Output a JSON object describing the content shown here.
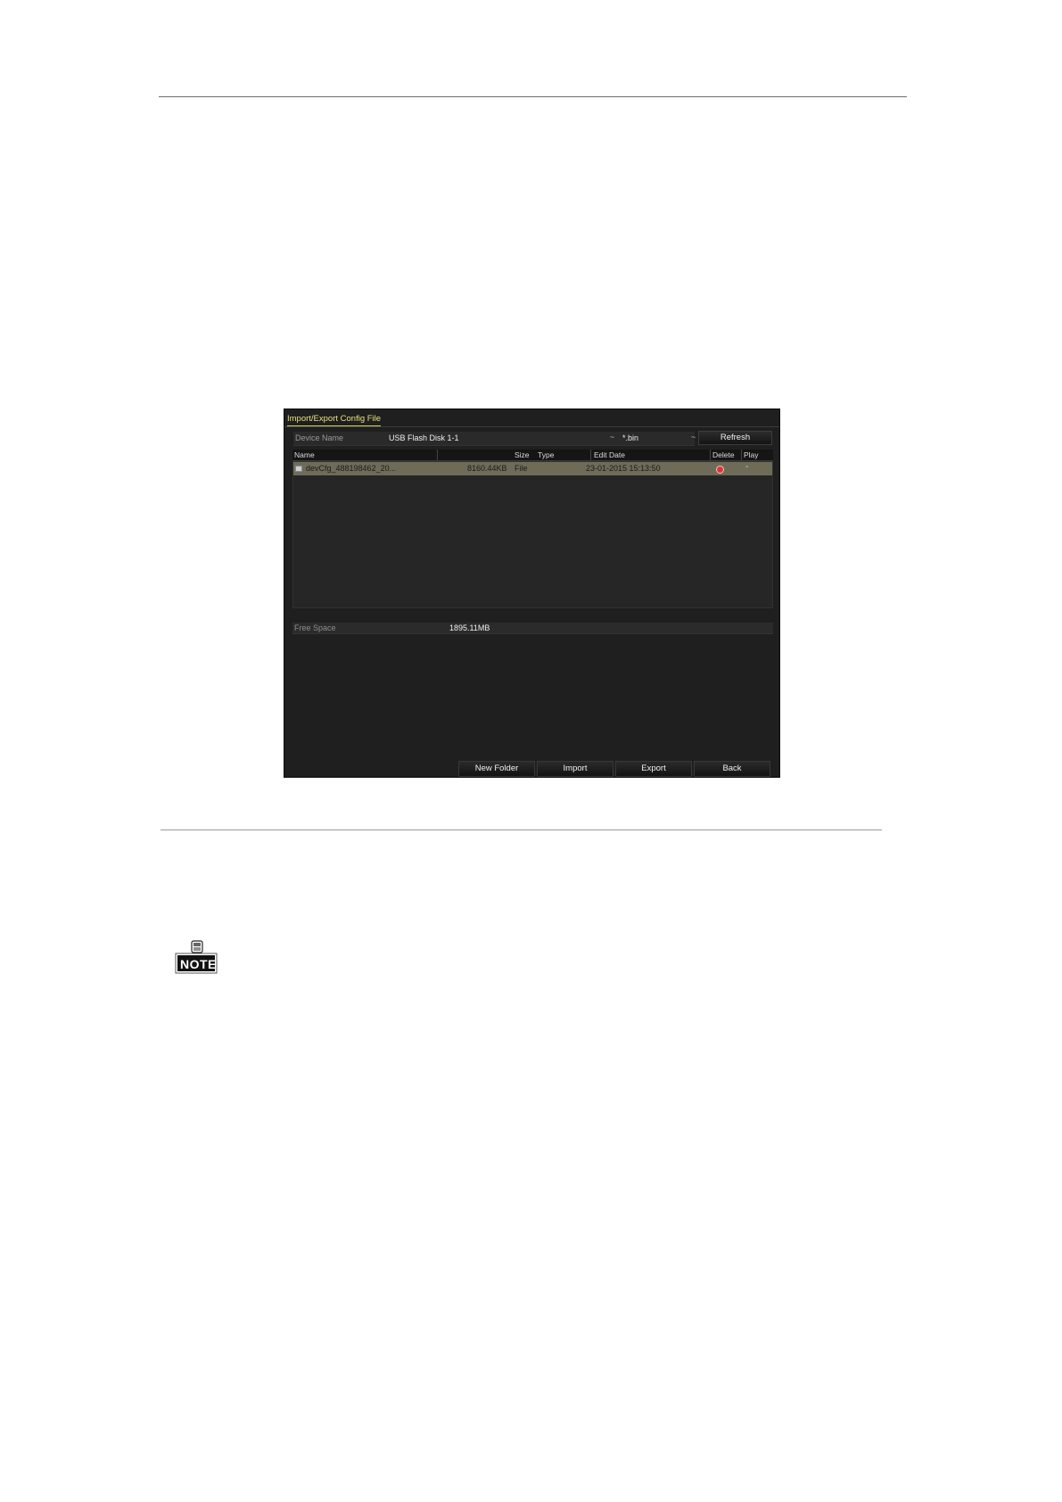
{
  "dialog": {
    "title": "Import/Export Config File",
    "device_label": "Device Name",
    "device_value": "USB Flash Disk 1-1",
    "filter_value": "*.bin",
    "refresh_label": "Refresh",
    "columns": {
      "name": "Name",
      "size": "Size",
      "type": "Type",
      "edit_date": "Edit Date",
      "delete": "Delete",
      "play": "Play"
    },
    "rows": [
      {
        "name": "devCfg_488198462_20...",
        "size": "8160.44KB",
        "type": "File",
        "edit_date": "23-01-2015 15:13:50",
        "play": "-"
      }
    ],
    "free_space_label": "Free Space",
    "free_space_value": "1895.11MB",
    "buttons": {
      "new_folder": "New Folder",
      "import": "Import",
      "export": "Export",
      "back": "Back"
    }
  },
  "note": {
    "label": "NOTE"
  }
}
